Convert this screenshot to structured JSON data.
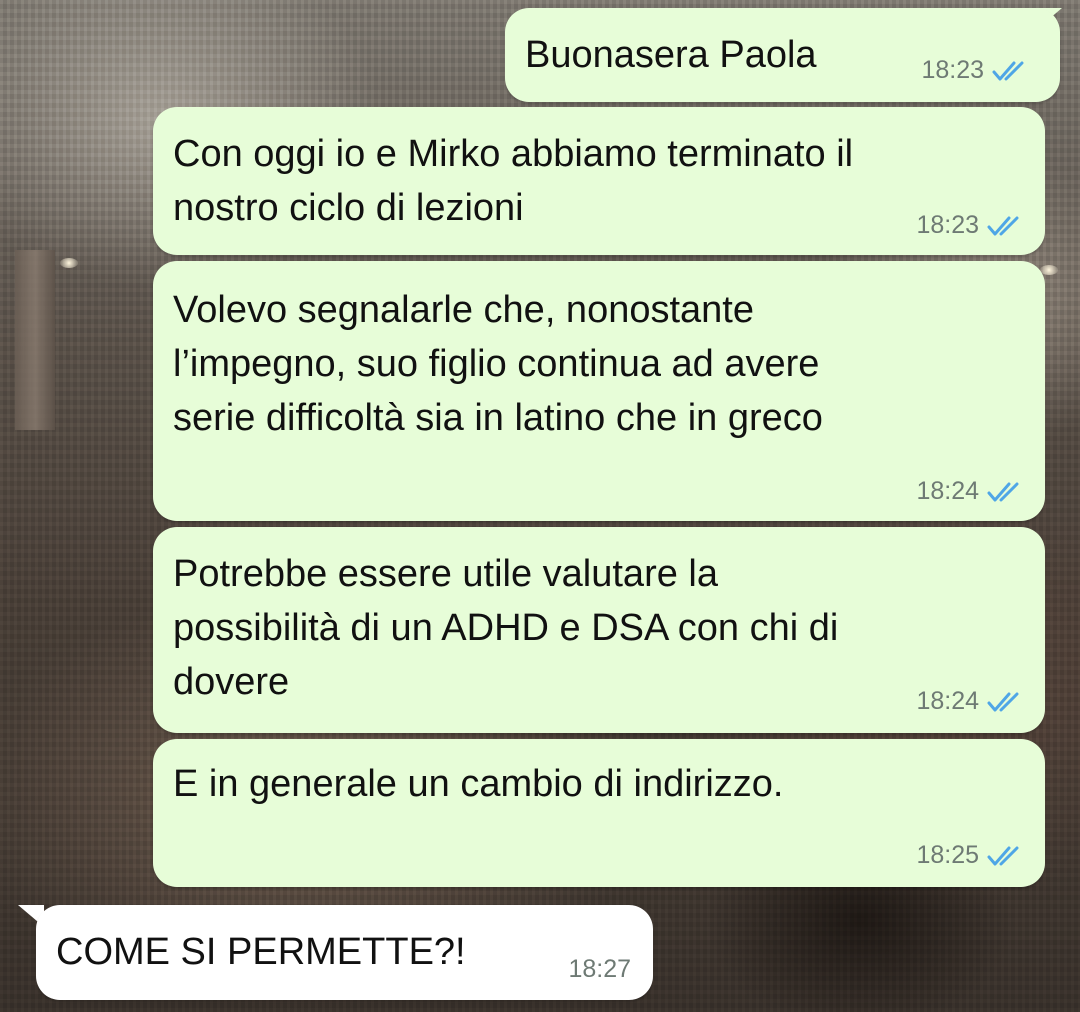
{
  "chat": {
    "messages": [
      {
        "direction": "outgoing",
        "text": "Buonasera Paola",
        "time": "18:23",
        "status_icon": "double-check-read-icon"
      },
      {
        "direction": "outgoing",
        "text": "Con oggi io e Mirko abbiamo terminato il\nnostro ciclo di lezioni",
        "time": "18:23",
        "status_icon": "double-check-read-icon"
      },
      {
        "direction": "outgoing",
        "text": "Volevo segnalarle che, nonostante\nl’impegno, suo figlio continua ad avere\nserie difficoltà sia in latino che in greco",
        "time": "18:24",
        "status_icon": "double-check-read-icon"
      },
      {
        "direction": "outgoing",
        "text": "Potrebbe essere utile valutare la\npossibilità di un ADHD e DSA con chi di\ndovere",
        "time": "18:24",
        "status_icon": "double-check-read-icon"
      },
      {
        "direction": "outgoing",
        "text": "E in generale un cambio di indirizzo.",
        "time": "18:25",
        "status_icon": "double-check-read-icon"
      },
      {
        "direction": "incoming",
        "text": "COME SI PERMETTE?!",
        "time": "18:27"
      }
    ]
  },
  "colors": {
    "outgoing_bubble": "#e7fdd8",
    "incoming_bubble": "#ffffff",
    "read_ticks": "#4fa6e6",
    "timestamp": "#6e7a74"
  }
}
